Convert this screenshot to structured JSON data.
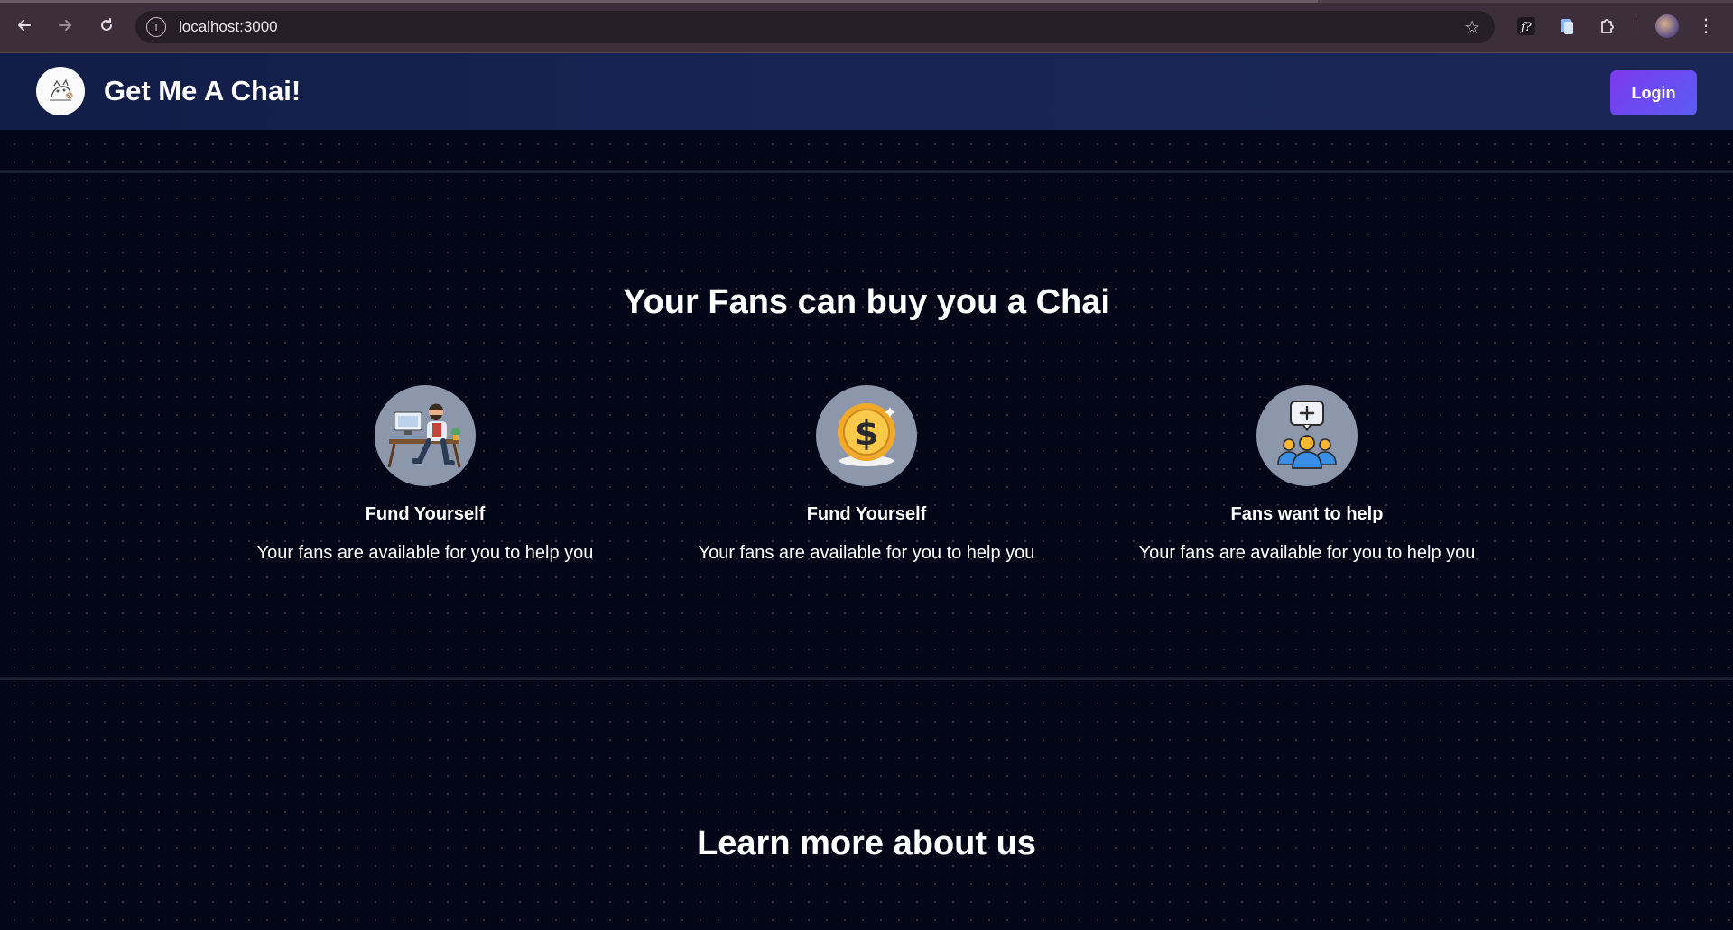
{
  "browser": {
    "url": "localhost:3000"
  },
  "header": {
    "brand": "Get Me A Chai!",
    "login_label": "Login"
  },
  "features": {
    "title": "Your Fans can buy you a Chai",
    "cards": [
      {
        "icon": "man-at-desk-illustration",
        "title": "Fund Yourself",
        "description": "Your fans are available for you to help you"
      },
      {
        "icon": "dollar-coin-icon",
        "title": "Fund Yourself",
        "description": "Your fans are available for you to help you"
      },
      {
        "icon": "group-chat-icon",
        "title": "Fans want to help",
        "description": "Your fans are available for you to help you"
      }
    ]
  },
  "about": {
    "title": "Learn more about us"
  },
  "colors": {
    "page_bg": "#030616",
    "nav_bg": "#172454",
    "login_btn": "#6d4af0",
    "icon_circle": "#8d97ab"
  }
}
